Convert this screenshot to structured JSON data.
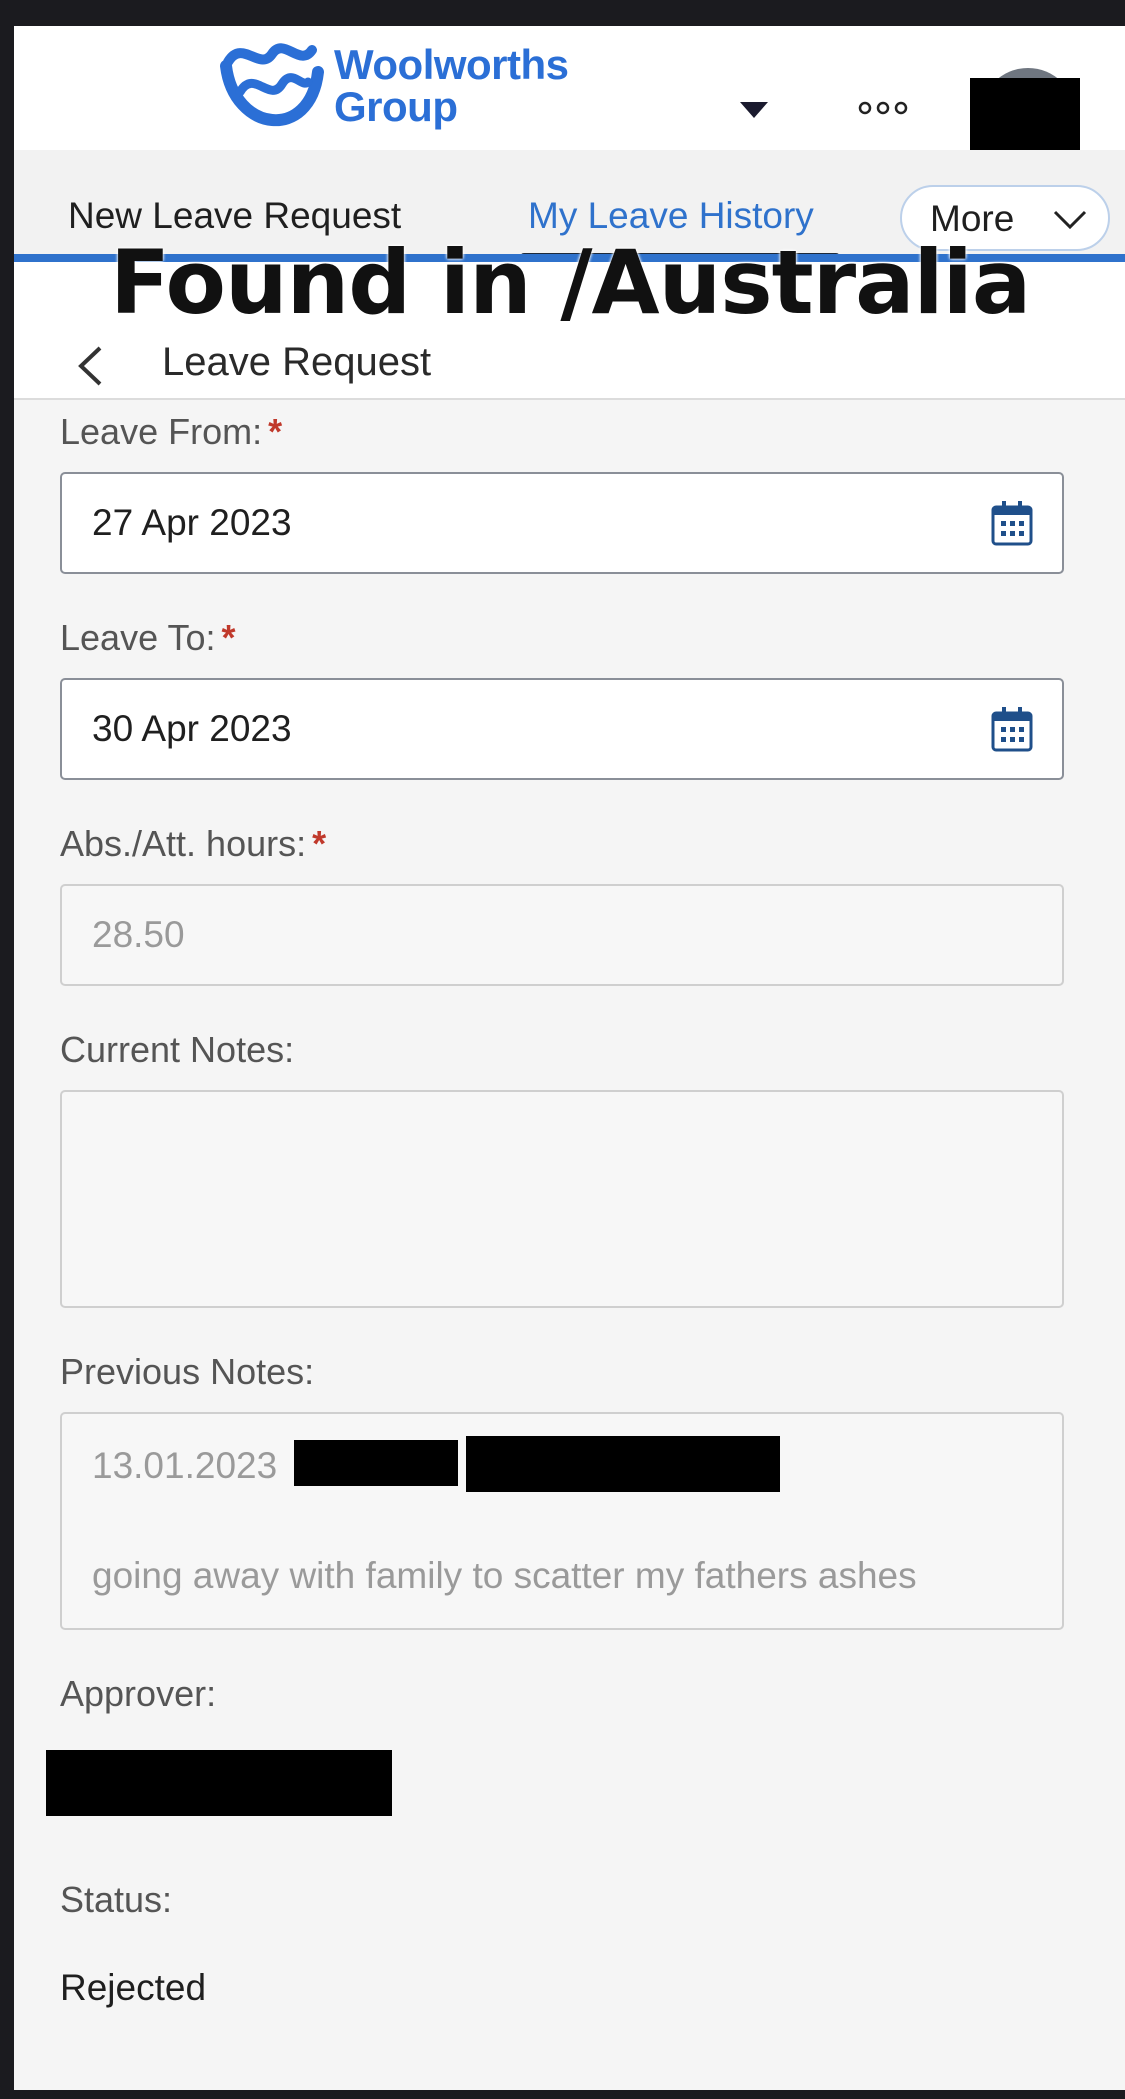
{
  "header": {
    "logo_line1": "Woolworths",
    "logo_line2": "Group",
    "brand_color": "#2b6fd6"
  },
  "tabs": {
    "new_leave": "New Leave Request",
    "history": "My Leave History",
    "more": "More",
    "active_color": "#2f72cc"
  },
  "watermark": "Found in /Australia",
  "page": {
    "title": "Leave Request"
  },
  "form": {
    "leave_from": {
      "label": "Leave From:",
      "required": "*",
      "value": "27 Apr 2023"
    },
    "leave_to": {
      "label": "Leave To:",
      "required": "*",
      "value": "30 Apr 2023"
    },
    "hours": {
      "label": "Abs./Att. hours:",
      "required": "*",
      "value": "28.50"
    },
    "current_notes": {
      "label": "Current Notes:",
      "value": ""
    },
    "previous_notes": {
      "label": "Previous Notes:",
      "date": "13.01.2023",
      "text": "going away with family to scatter my fathers ashes"
    },
    "approver": {
      "label": "Approver:"
    },
    "status": {
      "label": "Status:",
      "value": "Rejected"
    }
  },
  "icons": {
    "back": "back-chevron-icon",
    "calendar": "calendar-icon",
    "dropdown": "caret-down-icon",
    "overflow": "overflow-dots-icon",
    "chevron": "chevron-down-icon"
  }
}
